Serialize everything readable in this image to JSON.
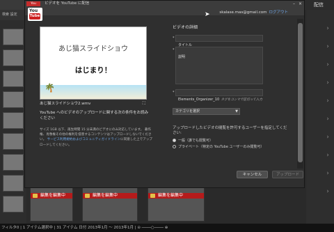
{
  "app": {
    "corner_label": "配信",
    "toolbar_text": "検索  設定",
    "status_bar": "フィルタ0 | 1 アイテム選択中 | 31 アイテム 日付 2013年1月 ～ 2013年1月 |  ⊝ ────○──── ⊕",
    "edit_banner": "編集を編集中"
  },
  "dialog": {
    "window_title": "ビデオを YouTube に配信",
    "youtube_logo_you": "You",
    "youtube_logo_tube": "Tube",
    "user_email": "skalase.mas@gmail.com",
    "logout_label": "ログアウト",
    "preview": {
      "title_line": "あじ猫スライドショウ",
      "subtitle_line": "はじまり！",
      "filename": "あじ猫スライドショウ2.wmv"
    },
    "terms_heading": "YouTube へのビデオのアップロードに関する次の条件をお読みください",
    "terms_body_1": "サイズ 1GB 以下、再生時間 15 分未満のビデオにのみ対応しています。",
    "terms_body_2": "著作権、肖像権その他の権利を侵害するコンテンツはアップロードしないでください。",
    "terms_link": "サービス利用規約およびコミュニティガイドライン",
    "terms_body_3": "に同意した上でアップロードしてください。",
    "video_info_title": "ビデオの詳細",
    "fields": {
      "title_label": "タイトル",
      "description_label": "説明",
      "tags_value": "Elements_Organizer_10",
      "tags_hint": "タグをコンマで区切って入力"
    },
    "category_placeholder": "カテゴリを選択",
    "privacy_question": "アップロードしたビデオの閲覧を許可するユーザーを指定してください:",
    "privacy_public": "一般（誰でも閲覧可）",
    "privacy_private": "プライベート（特定の YouTube ユーザーのみ閲覧可）",
    "cancel_label": "キャンセル",
    "upload_label": "アップロード"
  }
}
